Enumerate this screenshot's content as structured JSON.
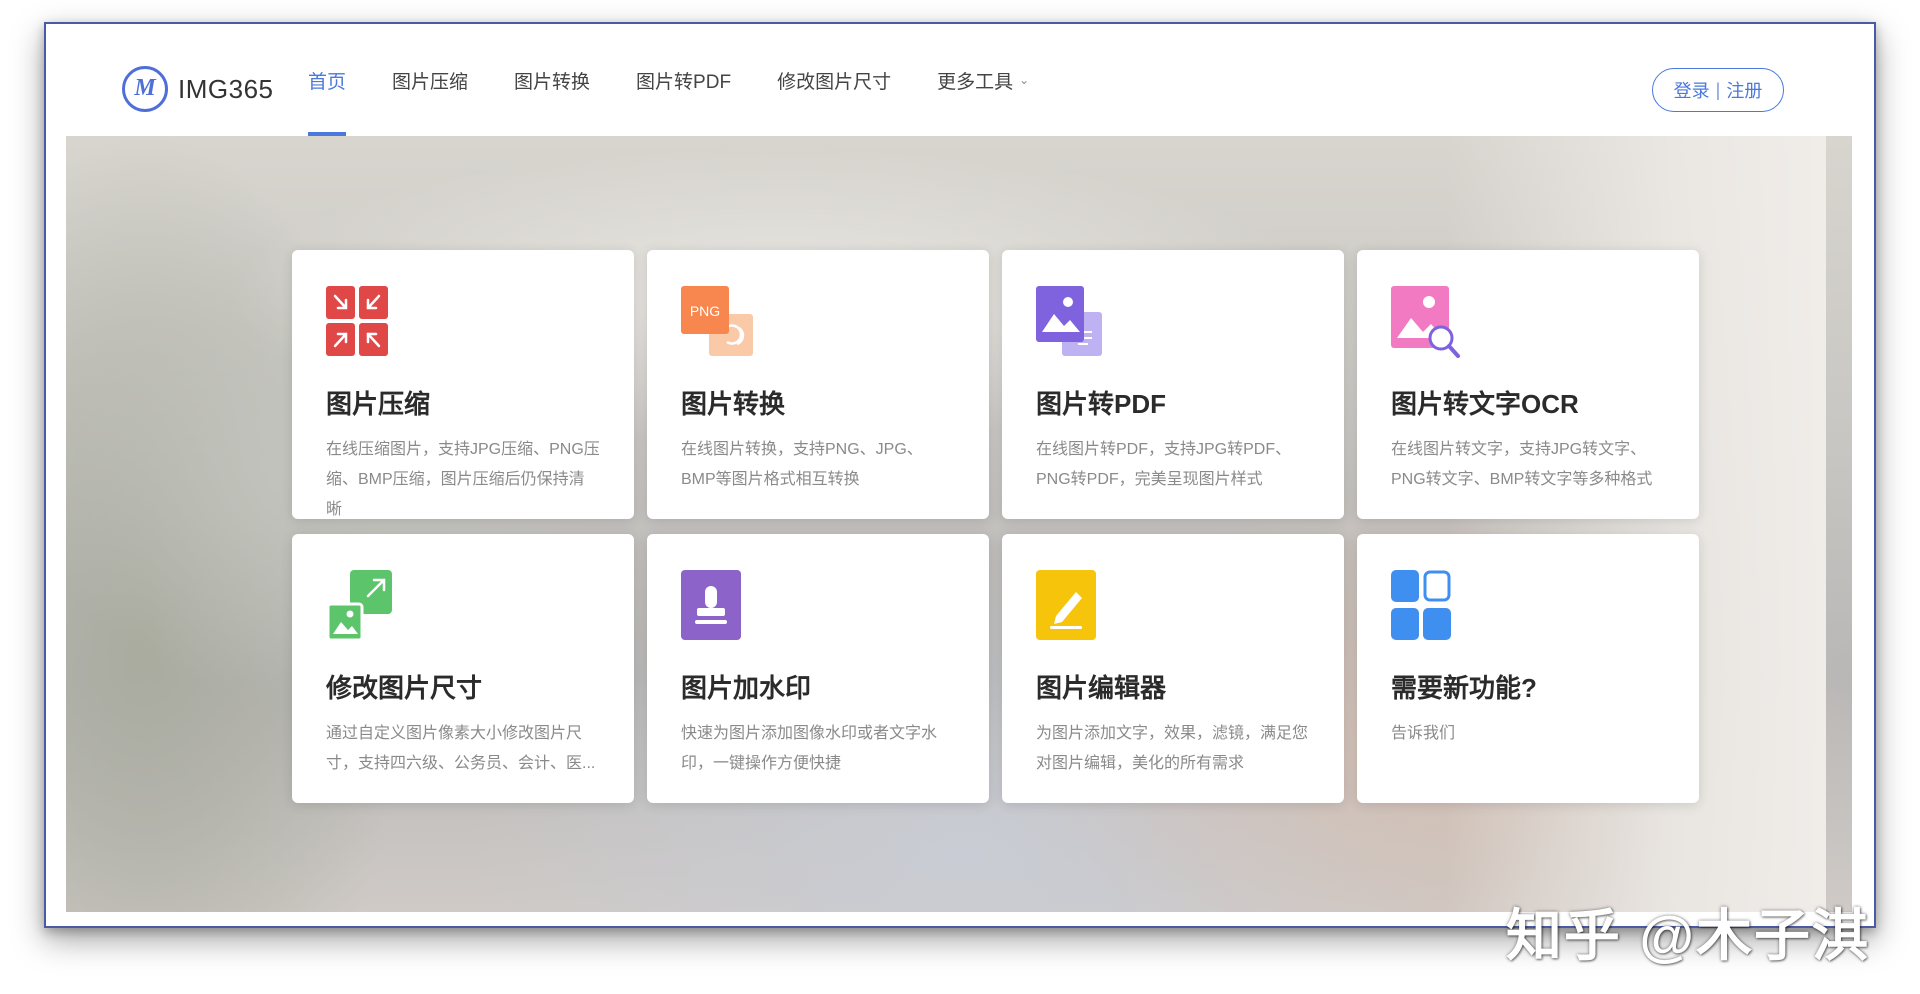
{
  "header": {
    "logo_mark": "M",
    "logo_text": "IMG365",
    "nav": [
      {
        "label": "首页",
        "active": true
      },
      {
        "label": "图片压缩"
      },
      {
        "label": "图片转换"
      },
      {
        "label": "图片转PDF"
      },
      {
        "label": "修改图片尺寸"
      },
      {
        "label": "更多工具",
        "dropdown": true
      }
    ],
    "login": "登录",
    "separator": "|",
    "register": "注册"
  },
  "cards": [
    {
      "icon": "compress-icon",
      "title": "图片压缩",
      "desc": "在线压缩图片，支持JPG压缩、PNG压缩、BMP压缩，图片压缩后仍保持清晰"
    },
    {
      "icon": "png-convert-icon",
      "title": "图片转换",
      "desc": "在线图片转换，支持PNG、JPG、BMP等图片格式相互转换",
      "icon_text": "PNG"
    },
    {
      "icon": "image-to-pdf-icon",
      "title": "图片转PDF",
      "desc": "在线图片转PDF，支持JPG转PDF、PNG转PDF，完美呈现图片样式"
    },
    {
      "icon": "image-ocr-icon",
      "title": "图片转文字OCR",
      "desc": "在线图片转文字，支持JPG转文字、PNG转文字、BMP转文字等多种格式"
    },
    {
      "icon": "resize-icon",
      "title": "修改图片尺寸",
      "desc": "通过自定义图片像素大小修改图片尺寸，支持四六级、公务员、会计、医..."
    },
    {
      "icon": "watermark-stamp-icon",
      "title": "图片加水印",
      "desc": "快速为图片添加图像水印或者文字水印，一键操作方便快捷"
    },
    {
      "icon": "edit-pencil-icon",
      "title": "图片编辑器",
      "desc": "为图片添加文字，效果，滤镜，满足您对图片编辑，美化的所有需求"
    },
    {
      "icon": "grid-apps-icon",
      "title": "需要新功能?",
      "desc": "告诉我们"
    }
  ],
  "watermark": "知乎 @木子淇",
  "colors": {
    "accent": "#4a78dd",
    "frame": "#4c5aa5"
  }
}
